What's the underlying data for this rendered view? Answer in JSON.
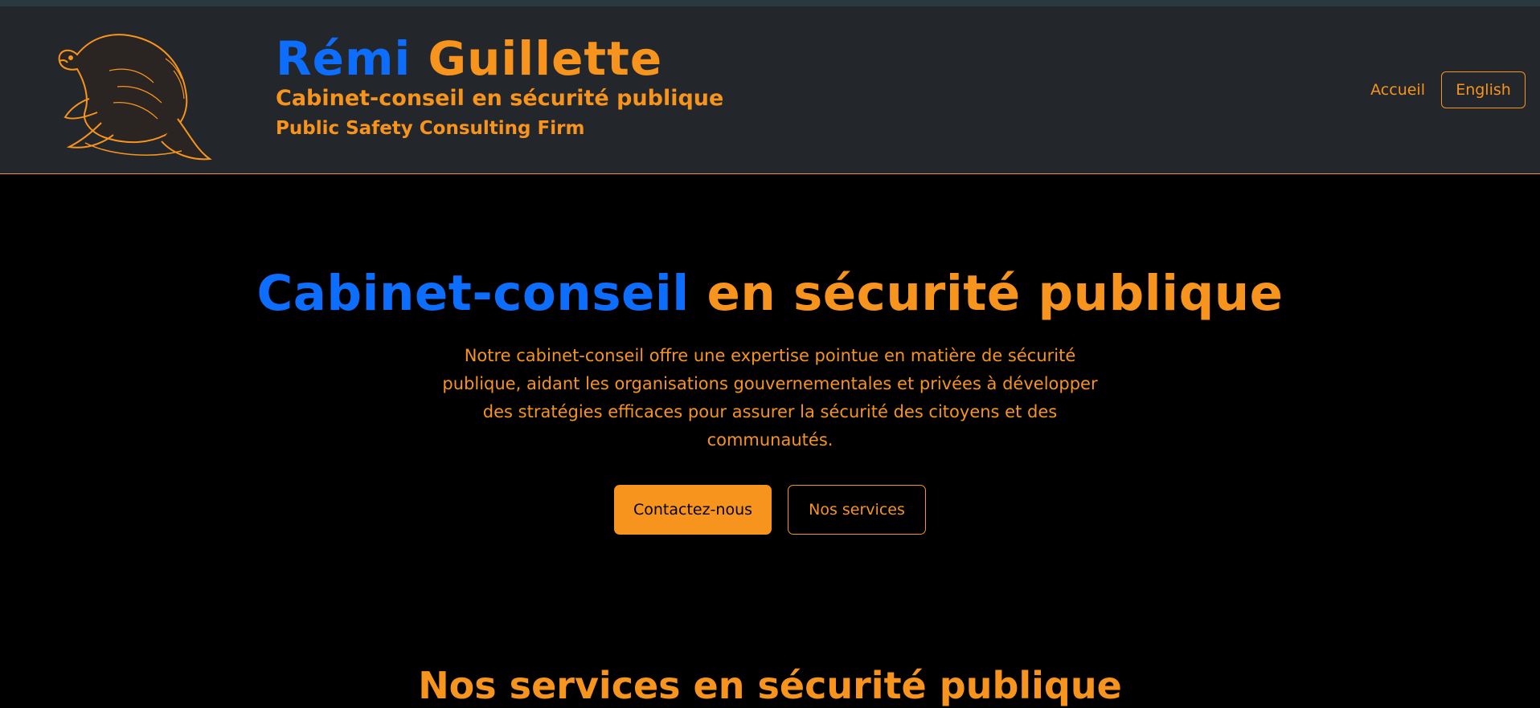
{
  "header": {
    "logo_icon": "beaver-icon",
    "brand_first": "Rémi",
    "brand_last": "Guillette",
    "subtitle_fr": "Cabinet-conseil en sécurité publique",
    "subtitle_en": "Public Safety Consulting Firm",
    "nav": {
      "home_label": "Accueil",
      "language_label": "English"
    }
  },
  "hero": {
    "title_highlight": "Cabinet-conseil",
    "title_rest": " en sécurité publique",
    "description": "Notre cabinet-conseil offre une expertise pointue en matière de sécurité publique, aidant les organisations gouvernementales et privées à développer des stratégies efficaces pour assurer la sécurité des citoyens et des communautés.",
    "primary_button": "Contactez-nous",
    "secondary_button": "Nos services"
  },
  "services": {
    "title": "Nos services en sécurité publique"
  },
  "colors": {
    "accent": "#f7941d",
    "brand_blue": "#0d6efd",
    "header_bg": "#23262b",
    "page_bg": "#000000"
  }
}
